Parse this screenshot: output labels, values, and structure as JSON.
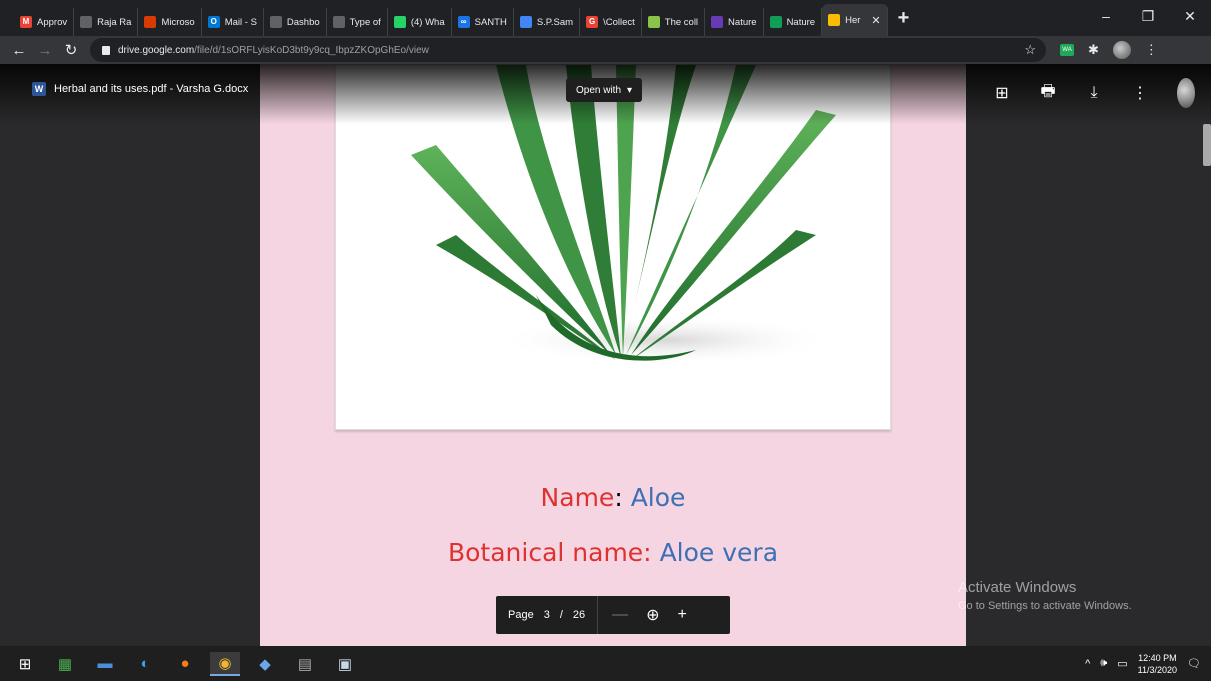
{
  "tabs": [
    {
      "label": "Approv",
      "icon": "gmail-icon",
      "color": "#ea4335",
      "glyph": "M"
    },
    {
      "label": "Raja Ra",
      "icon": "globe-icon",
      "color": "#5f6368",
      "glyph": ""
    },
    {
      "label": "Microso",
      "icon": "office-icon",
      "color": "#d83b01",
      "glyph": ""
    },
    {
      "label": "Mail - S",
      "icon": "outlook-icon",
      "color": "#0078d4",
      "glyph": "O"
    },
    {
      "label": "Dashbo",
      "icon": "dashboard-icon",
      "color": "#5f6368",
      "glyph": ""
    },
    {
      "label": "Type of",
      "icon": "globe-icon",
      "color": "#5f6368",
      "glyph": ""
    },
    {
      "label": "(4) Wha",
      "icon": "whatsapp-icon",
      "color": "#25d366",
      "glyph": ""
    },
    {
      "label": "SANTH",
      "icon": "loop-icon",
      "color": "#1a73e8",
      "glyph": "∞"
    },
    {
      "label": "S.P.Sam",
      "icon": "site-icon",
      "color": "#4285f4",
      "glyph": ""
    },
    {
      "label": "\\Collect",
      "icon": "google-icon",
      "color": "#ea4335",
      "glyph": "G"
    },
    {
      "label": "The coll",
      "icon": "plant-icon",
      "color": "#8bc34a",
      "glyph": ""
    },
    {
      "label": "Nature",
      "icon": "forms-icon",
      "color": "#673ab7",
      "glyph": ""
    },
    {
      "label": "Nature",
      "icon": "sheets-icon",
      "color": "#0f9d58",
      "glyph": ""
    },
    {
      "label": "Her",
      "icon": "drive-icon",
      "color": "#fbbc04",
      "glyph": "",
      "active": true
    }
  ],
  "toolbar": {
    "url_host": "drive.google.com",
    "url_path": "/file/d/1sORFLyisKoD3bt9y9cq_IbpzZKOpGhEo/view"
  },
  "viewer": {
    "doc_title": "Herbal and its uses.pdf - Varsha G.docx",
    "open_with": "Open with",
    "name_label": "Name",
    "name_value": "Aloe",
    "botanical_label": "Botanical name:",
    "botanical_value": "Aloe vera",
    "page_label": "Page",
    "page_current": "3",
    "page_sep": "/",
    "page_total": "26"
  },
  "watermark": {
    "line1": "Activate Windows",
    "line2": "Go to Settings to activate Windows."
  },
  "taskbar": {
    "time": "12:40 PM",
    "date": "11/3/2020"
  }
}
